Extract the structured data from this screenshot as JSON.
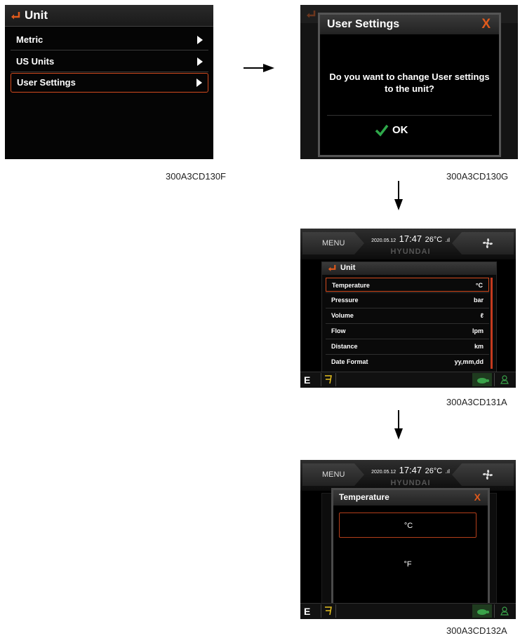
{
  "screen1": {
    "title": "Unit",
    "items": [
      {
        "label": "Metric"
      },
      {
        "label": "US Units"
      },
      {
        "label": "User Settings",
        "selected": true
      }
    ],
    "caption": "300A3CD130F"
  },
  "screen2": {
    "dialog_title": "User Settings",
    "close": "X",
    "message_line1": "Do you want to change User settings",
    "message_line2": "to the unit?",
    "ok_label": "OK",
    "caption": "300A3CD130G"
  },
  "statusbar": {
    "menu_label": "MENU",
    "date": "2020.05.12",
    "time": "17:47",
    "temperature": "26°C",
    "brand": "HYUNDAI",
    "mode": "E"
  },
  "screen3": {
    "title": "Unit",
    "rows": [
      {
        "label": "Temperature",
        "value": "°C"
      },
      {
        "label": "Pressure",
        "value": "bar"
      },
      {
        "label": "Volume",
        "value": "ℓ"
      },
      {
        "label": "Flow",
        "value": "lpm"
      },
      {
        "label": "Distance",
        "value": "km"
      },
      {
        "label": "Date Format",
        "value": "yy,mm,dd"
      }
    ],
    "caption": "300A3CD131A"
  },
  "screen4": {
    "dialog_title": "Temperature",
    "close": "X",
    "options": [
      "°C",
      "°F"
    ],
    "caption": "300A3CD132A"
  },
  "colors": {
    "accent": "#e05a1c",
    "ok_check": "#2ea84a"
  }
}
